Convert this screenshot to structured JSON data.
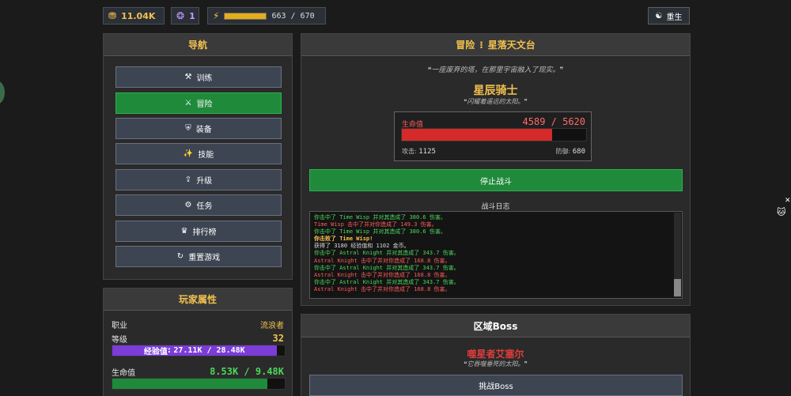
{
  "topbar": {
    "gold": "11.04K",
    "gems": "1",
    "energy_text": "663 / 670",
    "energy_fraction": 0.989,
    "rebirth_label": "重生"
  },
  "nav": {
    "title": "导航",
    "items": [
      {
        "label": "训练",
        "icon": "dumbbell-icon",
        "glyph": "⚒"
      },
      {
        "label": "冒险",
        "icon": "crossed-swords-icon",
        "glyph": "⚔"
      },
      {
        "label": "装备",
        "icon": "armor-icon",
        "glyph": "⛨"
      },
      {
        "label": "技能",
        "icon": "skill-icon",
        "glyph": "✨"
      },
      {
        "label": "升级",
        "icon": "wifi-icon",
        "glyph": "⇪"
      },
      {
        "label": "任务",
        "icon": "gear-icon",
        "glyph": "⚙"
      },
      {
        "label": "排行榜",
        "icon": "trophy-icon",
        "glyph": "♛"
      },
      {
        "label": "重置游戏",
        "icon": "reset-icon",
        "glyph": "↻"
      }
    ]
  },
  "stats": {
    "title": "玩家属性",
    "class_label": "职业",
    "class_value": "流浪者",
    "level_label": "等级",
    "level_value": "32",
    "xp_label": "经验值",
    "xp_text": "27.11K / 28.48K",
    "xp_fraction": 0.952,
    "hp_label": "生命值",
    "hp_text": "8.53K / 9.48K",
    "hp_fraction": 0.9
  },
  "adventure": {
    "title_prefix": "冒险",
    "location": "星落天文台",
    "location_quote": "一座废弃的塔，在那里宇宙融入了现实。",
    "enemy_name": "星辰骑士",
    "enemy_quote": "闪耀着遥远的太阳。",
    "enemy_hp_label": "生命值",
    "enemy_hp_text": "4589 / 5620",
    "enemy_hp_fraction": 0.817,
    "attack_label": "攻击",
    "attack_value": "1125",
    "defense_label": "防御",
    "defense_value": "680",
    "stop_label": "停止战斗",
    "log_title": "战斗日志",
    "log": [
      {
        "text": "你击中了 Time Wisp 并对其造成了 380.6 伤害。",
        "kind": "green"
      },
      {
        "text": "Time Wisp 击中了并对你造成了 149.3 伤害。",
        "kind": "red"
      },
      {
        "text": "你击中了 Time Wisp 并对其造成了 380.6 伤害。",
        "kind": "green"
      },
      {
        "text": "你击败了 Time Wisp!",
        "kind": "yellow"
      },
      {
        "text": "获得了 3180 经验值和 1102 金币。",
        "kind": "white"
      },
      {
        "text": "你击中了 Astral Knight 并对其造成了 343.7 伤害。",
        "kind": "green"
      },
      {
        "text": "Astral Knight 击中了并对你造成了 168.8 伤害。",
        "kind": "red"
      },
      {
        "text": "你击中了 Astral Knight 并对其造成了 343.7 伤害。",
        "kind": "green"
      },
      {
        "text": "Astral Knight 击中了并对你造成了 168.8 伤害。",
        "kind": "red"
      },
      {
        "text": "你击中了 Astral Knight 并对其造成了 343.7 伤害。",
        "kind": "green"
      },
      {
        "text": "Astral Knight 击中了并对你造成了 168.8 伤害。",
        "kind": "red"
      }
    ]
  },
  "boss": {
    "title": "区域Boss",
    "name": "噬星者艾塞尔",
    "quote": "它吞噬垂死的太阳。",
    "challenge_label": "挑战Boss"
  }
}
